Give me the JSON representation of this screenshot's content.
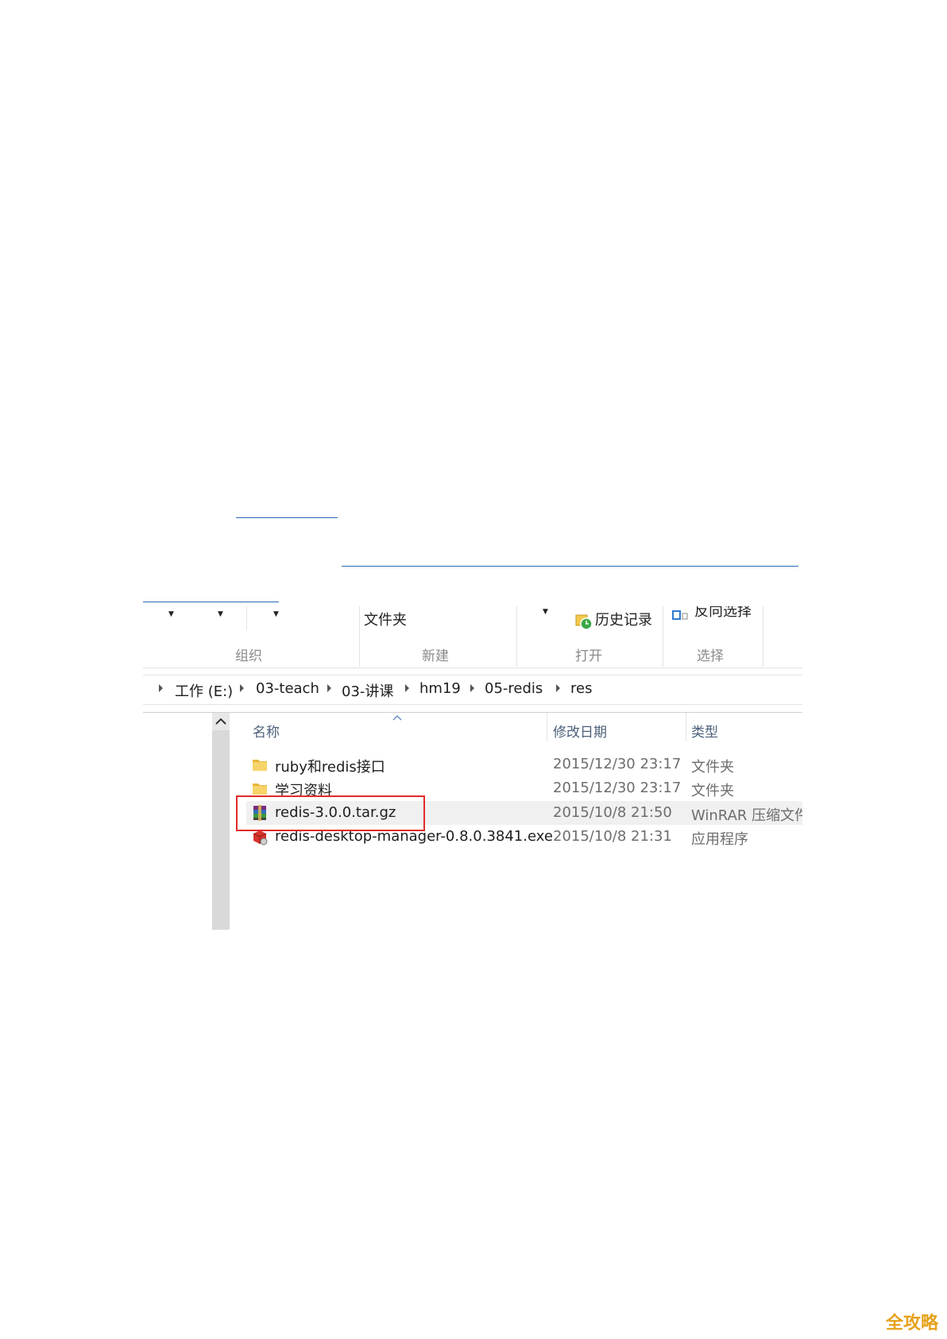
{
  "ribbon": {
    "new_folder_label": "文件夹",
    "history_label": "历史记录",
    "select_label": "反向选择",
    "groups": [
      "组织",
      "新建",
      "打开",
      "选择"
    ]
  },
  "breadcrumb": [
    "工作 (E:)",
    "03-teach",
    "03-讲课",
    "hm19",
    "05-redis",
    "res"
  ],
  "columns": {
    "name": "名称",
    "date": "修改日期",
    "type": "类型"
  },
  "files": [
    {
      "name": "ruby和redis接口",
      "date": "2015/12/30 23:17",
      "type": "文件夹",
      "icon": "folder-icon"
    },
    {
      "name": "学习资料",
      "date": "2015/12/30 23:17",
      "type": "文件夹",
      "icon": "folder-icon"
    },
    {
      "name": "redis-3.0.0.tar.gz",
      "date": "2015/10/8 21:50",
      "type": "WinRAR 压缩文件",
      "icon": "winrar-archive-icon"
    },
    {
      "name": "redis-desktop-manager-0.8.0.3841.exe",
      "date": "2015/10/8 21:31",
      "type": "应用程序",
      "icon": "exe-icon"
    }
  ],
  "highlight_color": "#e22a2a",
  "watermark": "全攻略"
}
